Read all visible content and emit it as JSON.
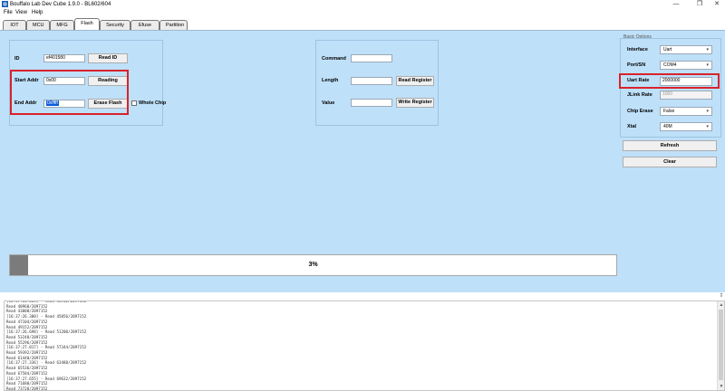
{
  "window": {
    "title": "Bouffalo Lab Dev Cube 1.9.0 - BL602/604",
    "minimize_glyph": "—",
    "maximize_glyph": "❐",
    "close_glyph": "✕"
  },
  "menu": [
    "File",
    "View",
    "Help"
  ],
  "tabs": [
    {
      "label": "IOT",
      "active": false
    },
    {
      "label": "MCU",
      "active": false
    },
    {
      "label": "MFG",
      "active": false
    },
    {
      "label": "Flash",
      "active": true
    },
    {
      "label": "Security",
      "active": false
    },
    {
      "label": "Efuse",
      "active": false
    },
    {
      "label": "Partition",
      "active": false
    }
  ],
  "flash_panel": {
    "id_label": "ID",
    "id_value": "ef401580",
    "read_id_button": "Read ID",
    "start_addr_label": "Start Addr",
    "start_addr_value": "0x00",
    "reading_button": "Reading",
    "end_addr_label": "End Addr",
    "end_addr_value": "0xfffff",
    "erase_flash_button": "Erase Flash",
    "whole_chip_label": "Whole Chip"
  },
  "register_panel": {
    "command_label": "Command",
    "command_value": "",
    "length_label": "Length",
    "length_value": "",
    "read_register_button": "Read Register",
    "value_label": "Value",
    "value_value": "",
    "write_register_button": "Write Register"
  },
  "basic_options": {
    "title": "Basic Options",
    "interface_label": "Interface",
    "interface_value": "Uart",
    "port_label": "Port/SN",
    "port_value": "COM4",
    "uart_rate_label": "Uart Rate",
    "uart_rate_value": "2000000",
    "jlink_rate_label": "JLink Rate",
    "jlink_rate_value": "1000",
    "chip_erase_label": "Chip Erase",
    "chip_erase_value": "False",
    "xtal_label": "Xtal",
    "xtal_value": "40M",
    "refresh_button": "Refresh",
    "clear_button": "Clear",
    "dropdown_arrow": "▾"
  },
  "progress": {
    "percent": 3,
    "label": "3%"
  },
  "log": {
    "lines": [
      "[16:37:26.064] - Read 38912/2097152",
      "Read 40960/2097152",
      "Read 43008/2097152",
      "[16:37:26.380] - Read 45056/2097152",
      "Read 47104/2097152",
      "Read 49152/2097152",
      "[16:37:26.698] - Read 51200/2097152",
      "Read 53248/2097152",
      "Read 55296/2097152",
      "[16:37:27.017] - Read 57344/2097152",
      "Read 59392/2097152",
      "Read 61440/2097152",
      "[16:37:27.336] - Read 63488/2097152",
      "Read 65536/2097152",
      "Read 67584/2097152",
      "[16:37:27.655] - Read 69632/2097152",
      "Read 71680/2097152",
      "Read 73728/2097152"
    ],
    "scroll_up": "▲",
    "scroll_down": "▼"
  },
  "splitter_glyph": "⇕",
  "colors": {
    "panel_bg": "#bfe0f9",
    "highlight_box": "#d9222b",
    "progress_fill": "#7b7b7b",
    "selection": "#0a5bd7"
  }
}
